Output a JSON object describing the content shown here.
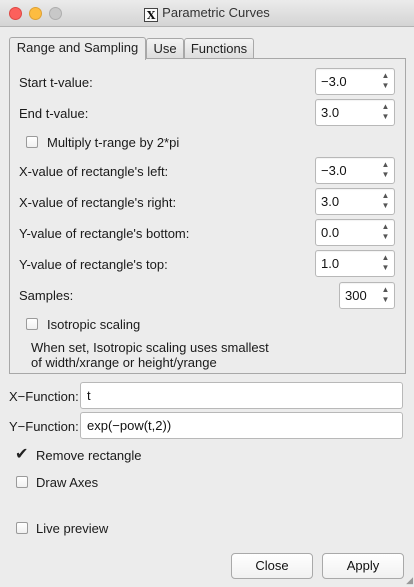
{
  "window": {
    "title": "Parametric Curves",
    "logo_letter": "X"
  },
  "tabs": [
    {
      "label": "Range and Sampling",
      "active": true
    },
    {
      "label": "Use",
      "active": false
    },
    {
      "label": "Functions",
      "active": false
    }
  ],
  "range": {
    "start_t_label": "Start t-value:",
    "start_t_value": "−3.0",
    "end_t_label": "End t-value:",
    "end_t_value": "3.0",
    "multiply_label": "Multiply t-range by 2*pi",
    "multiply_checked": false,
    "x_left_label": "X-value of rectangle's left:",
    "x_left_value": "−3.0",
    "x_right_label": "X-value of rectangle's right:",
    "x_right_value": "3.0",
    "y_bottom_label": "Y-value of rectangle's bottom:",
    "y_bottom_value": "0.0",
    "y_top_label": "Y-value of rectangle's top:",
    "y_top_value": "1.0",
    "samples_label": "Samples:",
    "samples_value": "300",
    "isotropic_label": "Isotropic scaling",
    "isotropic_checked": false,
    "isotropic_note_line1": "When set, Isotropic scaling uses smallest",
    "isotropic_note_line2": "of width/xrange or height/yrange"
  },
  "functions": {
    "x_label": "X−Function:",
    "x_value": "t",
    "y_label": "Y−Function:",
    "y_value": "exp(−pow(t,2))"
  },
  "options": {
    "remove_rectangle_label": "Remove rectangle",
    "remove_rectangle_checked": true,
    "draw_axes_label": "Draw Axes",
    "draw_axes_checked": false,
    "live_preview_label": "Live preview",
    "live_preview_checked": false
  },
  "buttons": {
    "close_label": "Close",
    "apply_label": "Apply"
  },
  "icons": {
    "checkmark": "check-icon",
    "spinner_up": "chevron-up-icon",
    "spinner_down": "chevron-down-icon"
  }
}
